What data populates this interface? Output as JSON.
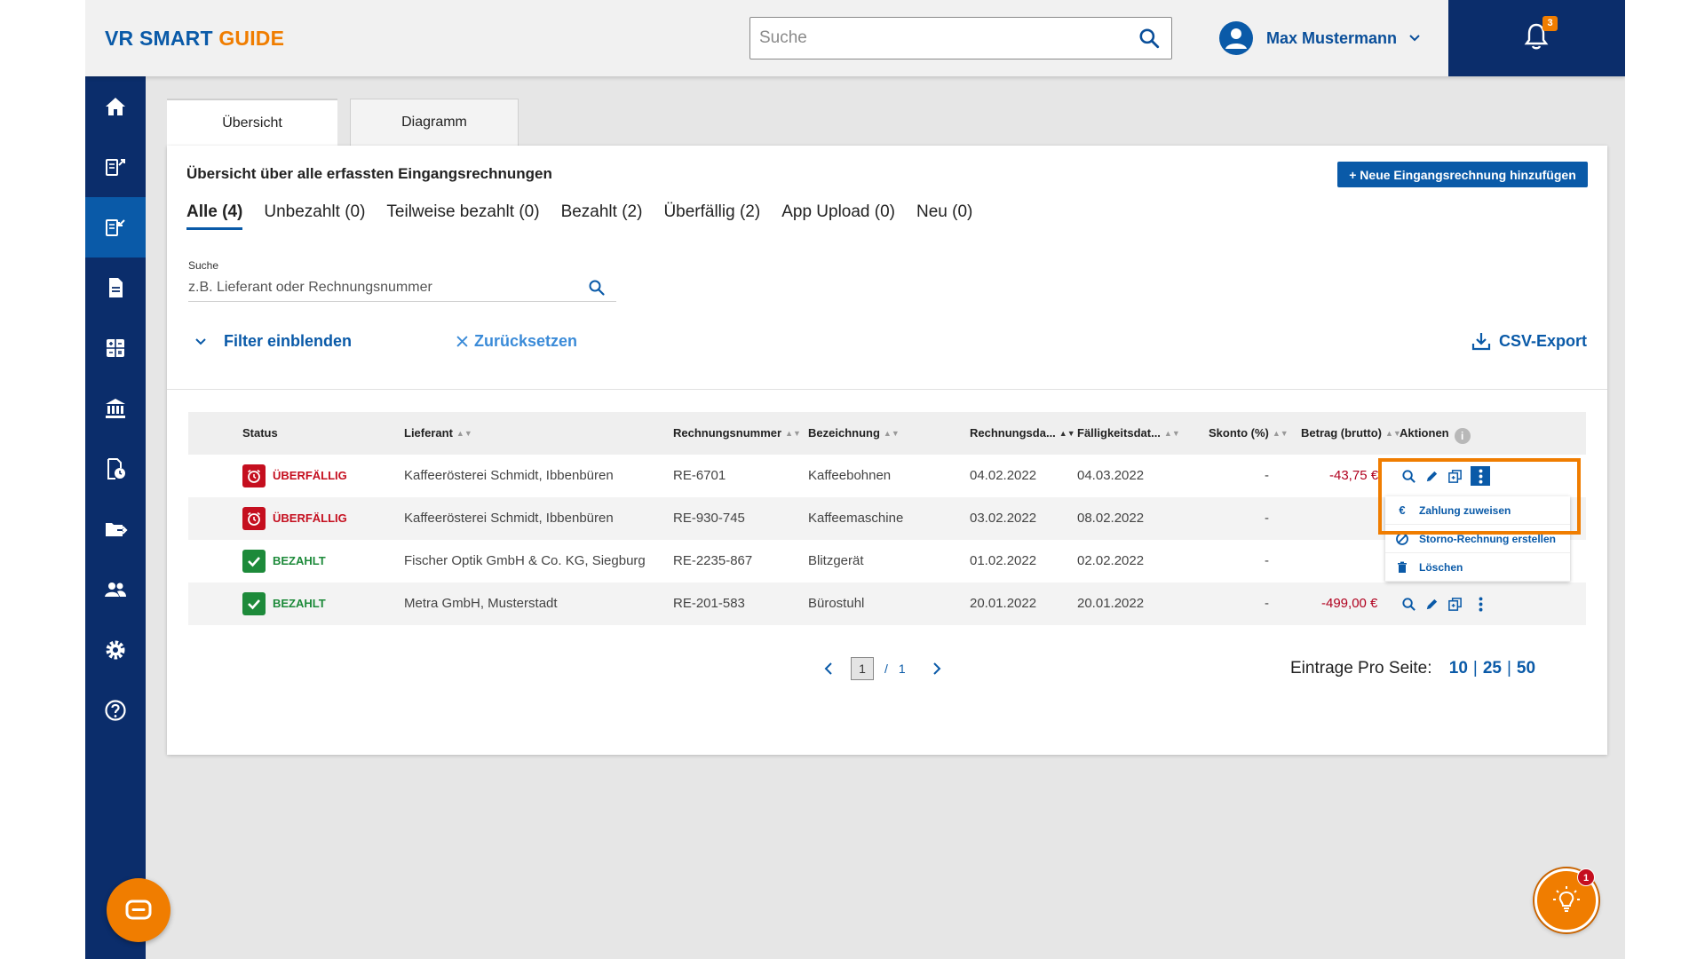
{
  "app": {
    "logo_part1": "VR SMART",
    "logo_part2": "GUIDE",
    "search_placeholder": "Suche",
    "user_name": "Max Mustermann",
    "notification_count": "3"
  },
  "sidebar": {
    "items": [
      {
        "icon": "home-icon"
      },
      {
        "icon": "outgoing-invoice-icon"
      },
      {
        "icon": "incoming-invoice-icon",
        "active": true
      },
      {
        "icon": "document-icon"
      },
      {
        "icon": "calculator-icon"
      },
      {
        "icon": "bank-icon"
      },
      {
        "icon": "document-clock-icon"
      },
      {
        "icon": "folder-export-icon"
      },
      {
        "icon": "users-icon"
      },
      {
        "icon": "settings-icon"
      },
      {
        "icon": "help-icon"
      }
    ]
  },
  "tabs": [
    "Übersicht",
    "Diagramm"
  ],
  "main": {
    "title": "Übersicht über alle erfassten Eingangsrechnungen",
    "add_button": "+ Neue Eingangsrechnung hinzufügen",
    "filters": [
      "Alle (4)",
      "Unbezahlt (0)",
      "Teilweise bezahlt (0)",
      "Bezahlt (2)",
      "Überfällig (2)",
      "App Upload (0)",
      "Neu (0)"
    ],
    "search_label": "Suche",
    "search_placeholder": "z.B. Lieferant oder Rechnungsnummer",
    "filter_toggle": "Filter einblenden",
    "reset": "Zurücksetzen",
    "csv_export": "CSV-Export"
  },
  "table": {
    "headers": [
      "Status",
      "Lieferant",
      "Rechnungsnummer",
      "Bezeichnung",
      "Rechnungsda...",
      "Fälligkeitsdat...",
      "Skonto (%)",
      "Betrag (brutto)",
      "Aktionen"
    ],
    "rows": [
      {
        "status": "ÜBERFÄLLIG",
        "supplier": "Kaffeerösterei Schmidt, Ibbenbüren",
        "number": "RE-6701",
        "description": "Kaffeebohnen",
        "invoice_date": "04.02.2022",
        "due_date": "04.03.2022",
        "discount": "-",
        "amount": "-43,75 €"
      },
      {
        "status": "ÜBERFÄLLIG",
        "supplier": "Kaffeerösterei Schmidt, Ibbenbüren",
        "number": "RE-930-745",
        "description": "Kaffeemaschine",
        "invoice_date": "03.02.2022",
        "due_date": "08.02.2022",
        "discount": "-",
        "amount": ""
      },
      {
        "status": "BEZAHLT",
        "supplier": "Fischer Optik GmbH & Co. KG, Siegburg",
        "number": "RE-2235-867",
        "description": "Blitzgerät",
        "invoice_date": "01.02.2022",
        "due_date": "02.02.2022",
        "discount": "-",
        "amount": ""
      },
      {
        "status": "BEZAHLT",
        "supplier": "Metra GmbH, Musterstadt",
        "number": "RE-201-583",
        "description": "Bürostuhl",
        "invoice_date": "20.01.2022",
        "due_date": "20.01.2022",
        "discount": "-",
        "amount": "-499,00 €"
      }
    ]
  },
  "action_menu": [
    "Zahlung zuweisen",
    "Storno-Rechnung erstellen",
    "Löschen"
  ],
  "pagination": {
    "current": "1",
    "separator": "/",
    "total": "1",
    "per_page_label": "Eintrage Pro Seite:",
    "sizes": [
      "10",
      "25",
      "50"
    ]
  },
  "bulb_badge": "1",
  "colors": {
    "primary": "#0a5aa8",
    "navy": "#0b2d6b",
    "accent": "#f07d00",
    "overdue": "#c50f1f",
    "paid": "#1d8a3a"
  }
}
